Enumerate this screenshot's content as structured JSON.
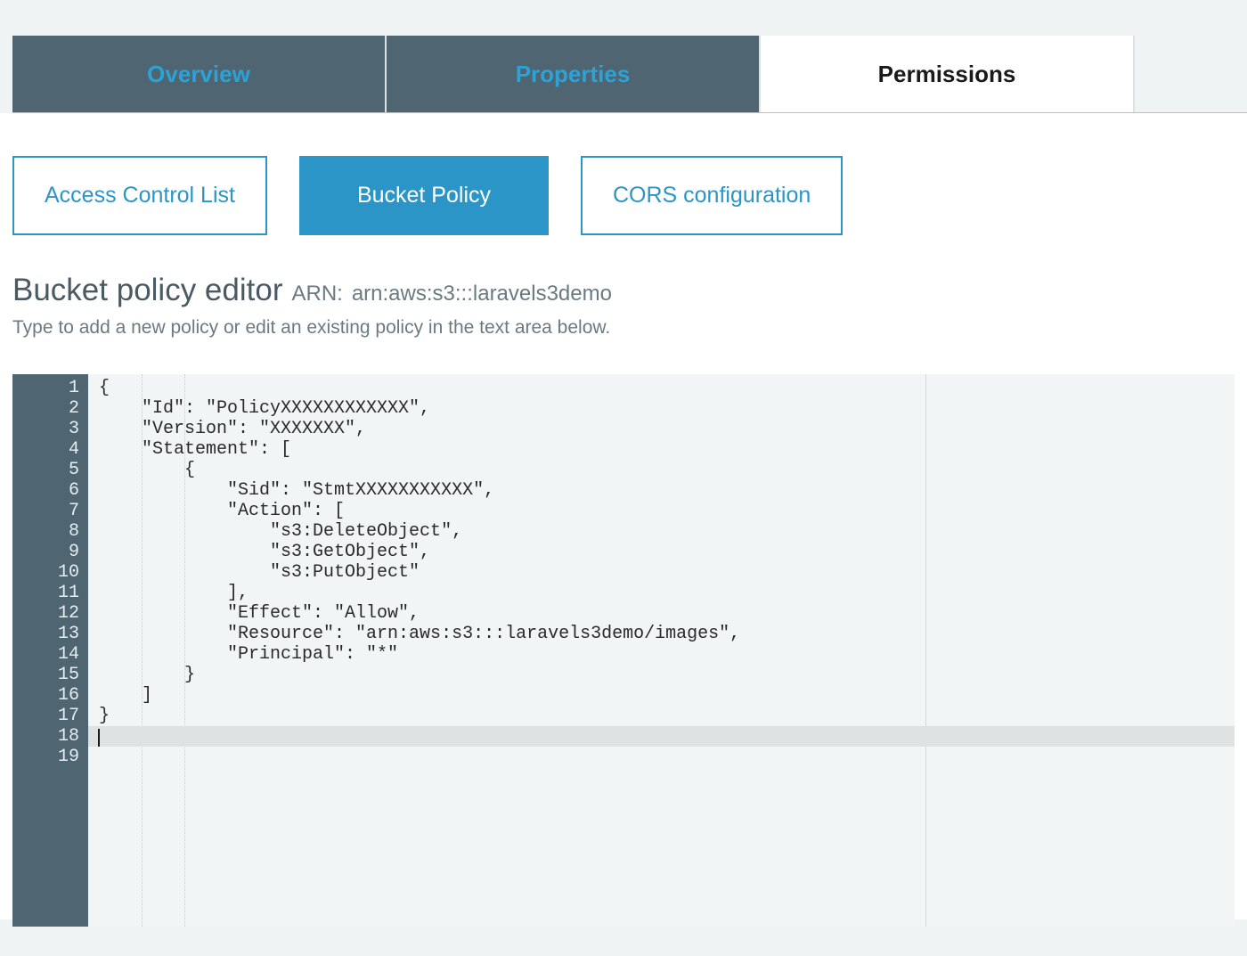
{
  "tabs": [
    {
      "label": "Overview",
      "active": false
    },
    {
      "label": "Properties",
      "active": false
    },
    {
      "label": "Permissions",
      "active": true
    }
  ],
  "subtabs": [
    {
      "label": "Access Control List",
      "active": false
    },
    {
      "label": "Bucket Policy",
      "active": true
    },
    {
      "label": "CORS configuration",
      "active": false
    }
  ],
  "editor": {
    "title": "Bucket policy editor",
    "arn_label": "ARN:",
    "arn_value": "arn:aws:s3:::laravels3demo",
    "subtitle": "Type to add a new policy or edit an existing policy in the text area below.",
    "line_count": 19,
    "active_line": 18,
    "code_lines": [
      "{",
      "    \"Id\": \"PolicyXXXXXXXXXXXX\",",
      "    \"Version\": \"XXXXXXX\",",
      "    \"Statement\": [",
      "        {",
      "            \"Sid\": \"StmtXXXXXXXXXXX\",",
      "            \"Action\": [",
      "                \"s3:DeleteObject\",",
      "                \"s3:GetObject\",",
      "                \"s3:PutObject\"",
      "            ],",
      "            \"Effect\": \"Allow\",",
      "            \"Resource\": \"arn:aws:s3:::laravels3demo/images\",",
      "            \"Principal\": \"*\"",
      "        }",
      "    ]",
      "}",
      "",
      ""
    ]
  }
}
